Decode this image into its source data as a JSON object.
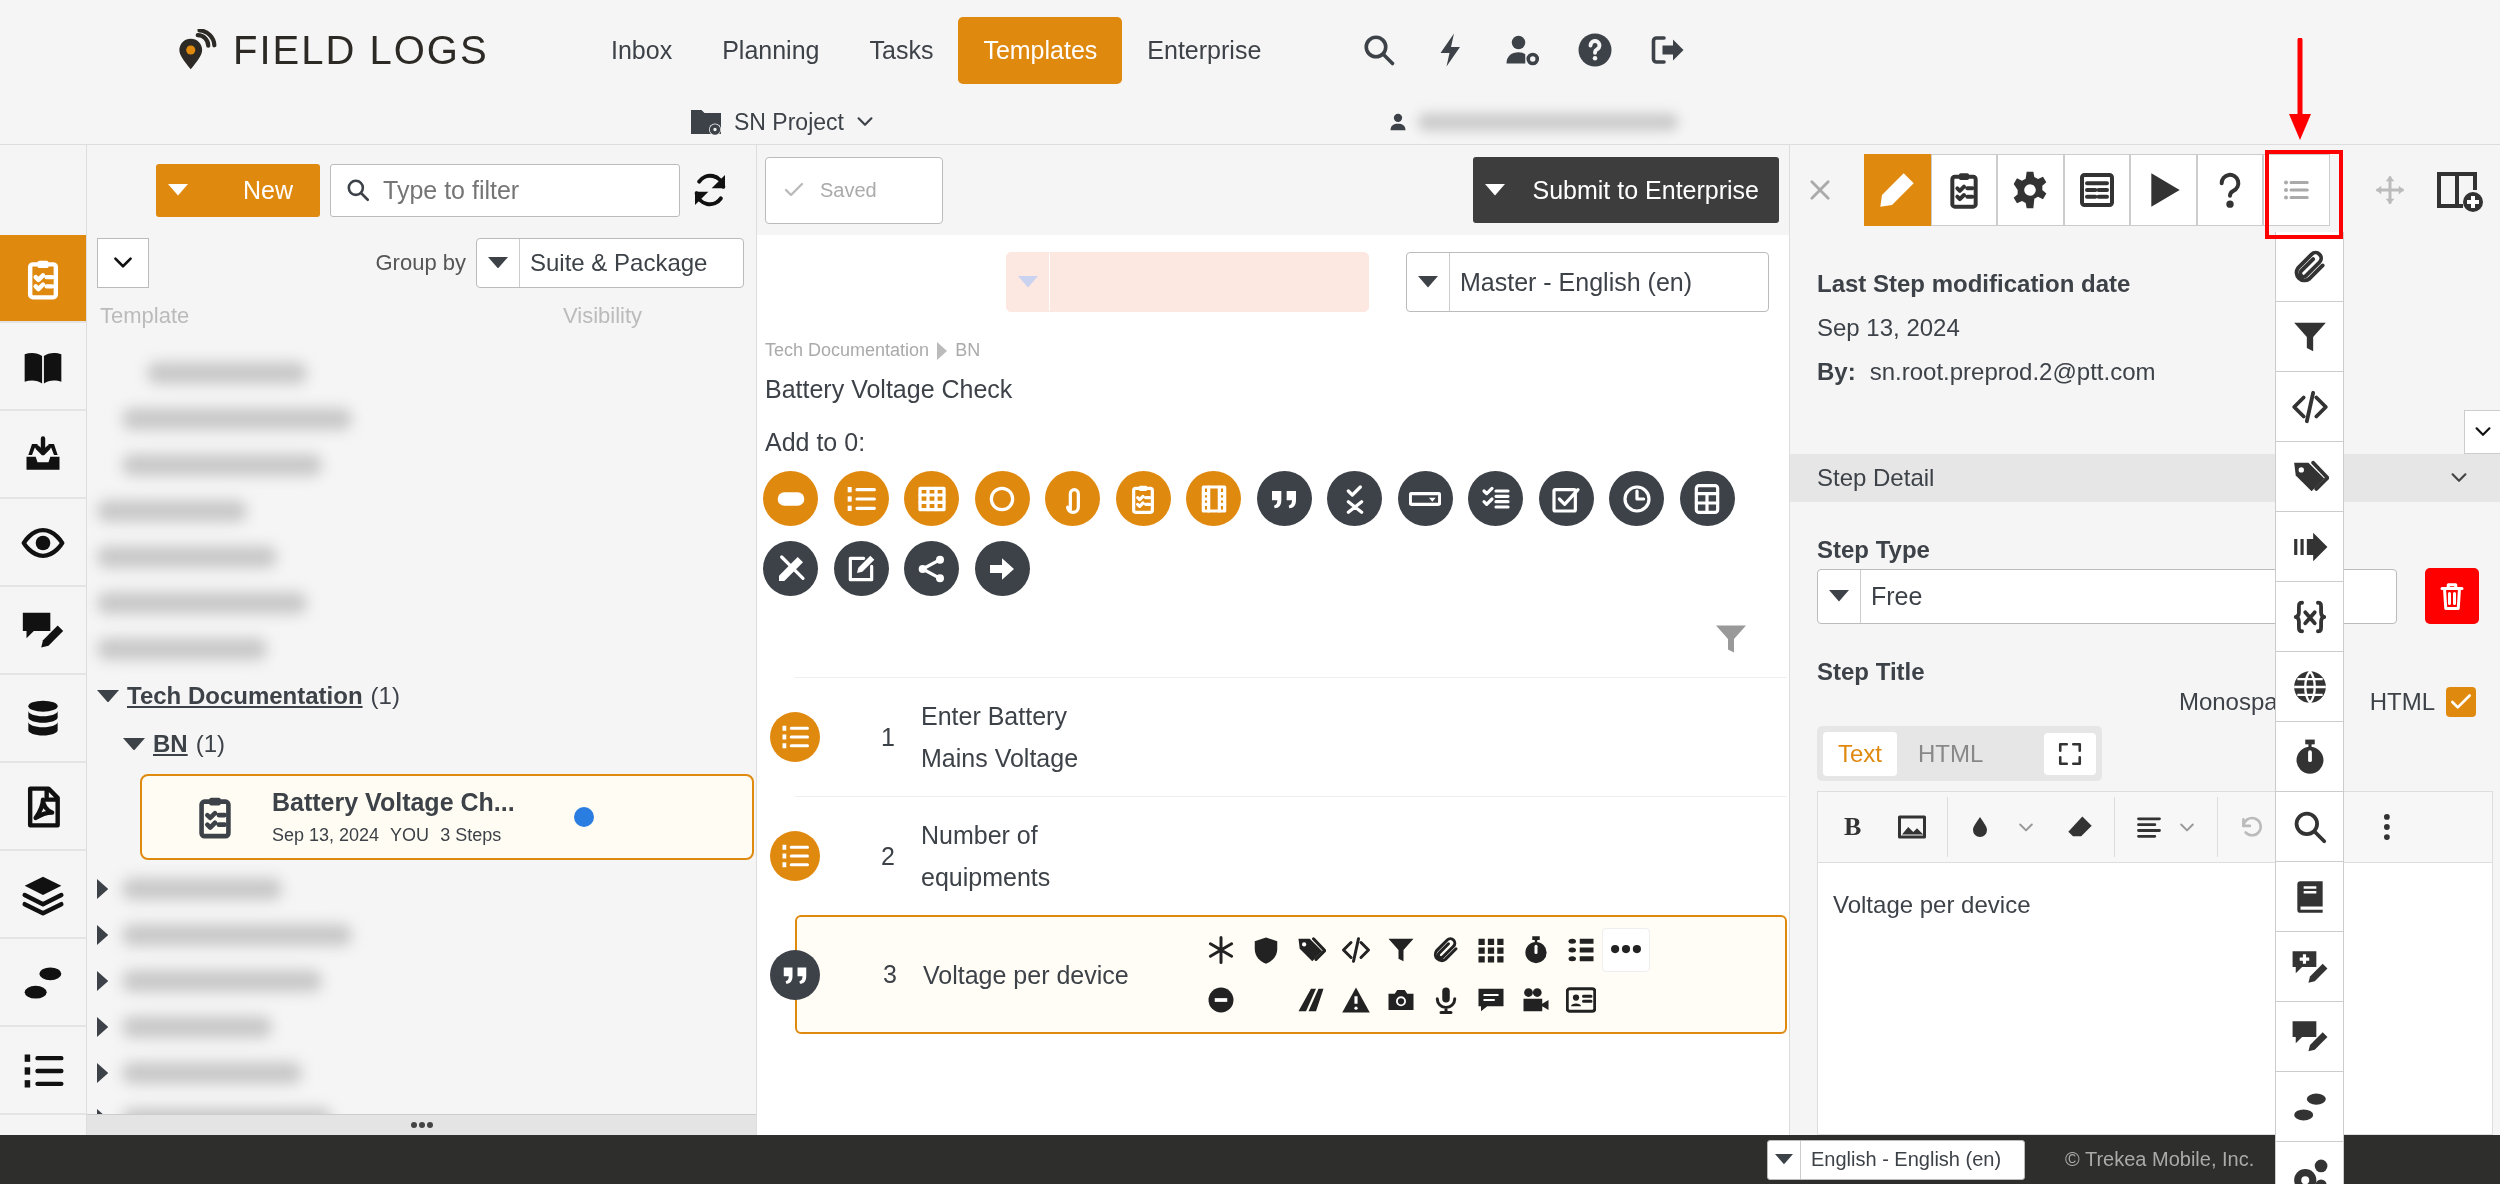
{
  "header": {
    "logo": "FIELD LOGS",
    "nav": [
      {
        "label": "Inbox",
        "selected": false
      },
      {
        "label": "Planning",
        "selected": false
      },
      {
        "label": "Tasks",
        "selected": false
      },
      {
        "label": "Templates",
        "selected": true
      },
      {
        "label": "Enterprise",
        "selected": false
      }
    ],
    "project": "SN Project"
  },
  "rail": [
    {
      "selected": true
    },
    {
      "selected": false
    },
    {
      "selected": false
    },
    {
      "selected": false
    },
    {
      "selected": false
    },
    {
      "selected": false
    },
    {
      "selected": false
    },
    {
      "selected": false
    },
    {
      "selected": false
    },
    {
      "selected": false
    }
  ],
  "library": {
    "new_button": "New",
    "filter_placeholder": "Type to filter",
    "group_by_label": "Group by",
    "group_by_value": "Suite & Package",
    "columns": [
      "Template",
      "Visibility"
    ],
    "tree": [
      {
        "label": "Tech Documentation",
        "count": "(1)",
        "expanded": true,
        "children": [
          {
            "label": "BN",
            "count": "(1)",
            "expanded": true,
            "templates": [
              {
                "title": "Battery Voltage Ch...",
                "date": "Sep 13, 2024",
                "owner": "YOU",
                "steps": "3 Steps",
                "selected": true,
                "color": "#2a7de1"
              }
            ]
          }
        ]
      }
    ]
  },
  "editor": {
    "saved_button": "Saved",
    "submit_button": "Submit to Enterprise",
    "version_select": {
      "error": true
    },
    "language": "Master - English (en)",
    "breadcrumb": [
      "Tech Documentation",
      "BN"
    ],
    "title": "Battery Voltage Check",
    "add_label": "Add to 0:",
    "palette": [
      {
        "color": "#e0890f"
      },
      {
        "color": "#e0890f"
      },
      {
        "color": "#e0890f"
      },
      {
        "color": "#e0890f"
      },
      {
        "color": "#e0890f"
      },
      {
        "color": "#e0890f"
      },
      {
        "color": "#e0890f"
      },
      {
        "color": "#3d4248"
      },
      {
        "color": "#3d4248"
      },
      {
        "color": "#3d4248"
      },
      {
        "color": "#3d4248"
      },
      {
        "color": "#3d4248"
      },
      {
        "color": "#3d4248"
      },
      {
        "color": "#3d4248"
      },
      {
        "color": "#3d4248"
      },
      {
        "color": "#3d4248"
      },
      {
        "color": "#3d4248"
      },
      {
        "color": "#3d4248"
      }
    ],
    "steps": [
      {
        "number": "1",
        "title": "Enter Battery Mains Voltage",
        "kind": "list",
        "selected": false
      },
      {
        "number": "2",
        "title": "Number of equipments",
        "kind": "list",
        "selected": false
      },
      {
        "number": "3",
        "title": "Voltage per device",
        "kind": "quote",
        "selected": true
      }
    ]
  },
  "details": {
    "toolbar": [
      {
        "selected": true
      },
      {
        "selected": false
      },
      {
        "selected": false
      },
      {
        "selected": false
      },
      {
        "selected": false
      },
      {
        "selected": false
      },
      {
        "selected": false
      }
    ],
    "modified_label": "Last Step modification date",
    "modified_date": "Sep 13, 2024",
    "by_label": "By:",
    "by_value": "sn.root.preprod.2@ptt.com",
    "section": "Step Detail",
    "section_expanded": true,
    "step_type_label": "Step Type",
    "step_type": "Free",
    "step_title_label": "Step Title",
    "monospace_label": "Monospa",
    "html_label": "HTML",
    "html_checked": true,
    "editor_tabs": [
      {
        "label": "Text",
        "selected": true
      },
      {
        "label": "HTML",
        "selected": false
      }
    ],
    "bold_label": "B",
    "content": "Voltage per device"
  },
  "footer": {
    "language": "English - English (en)",
    "copyright": "© Trekea Mobile, Inc."
  }
}
